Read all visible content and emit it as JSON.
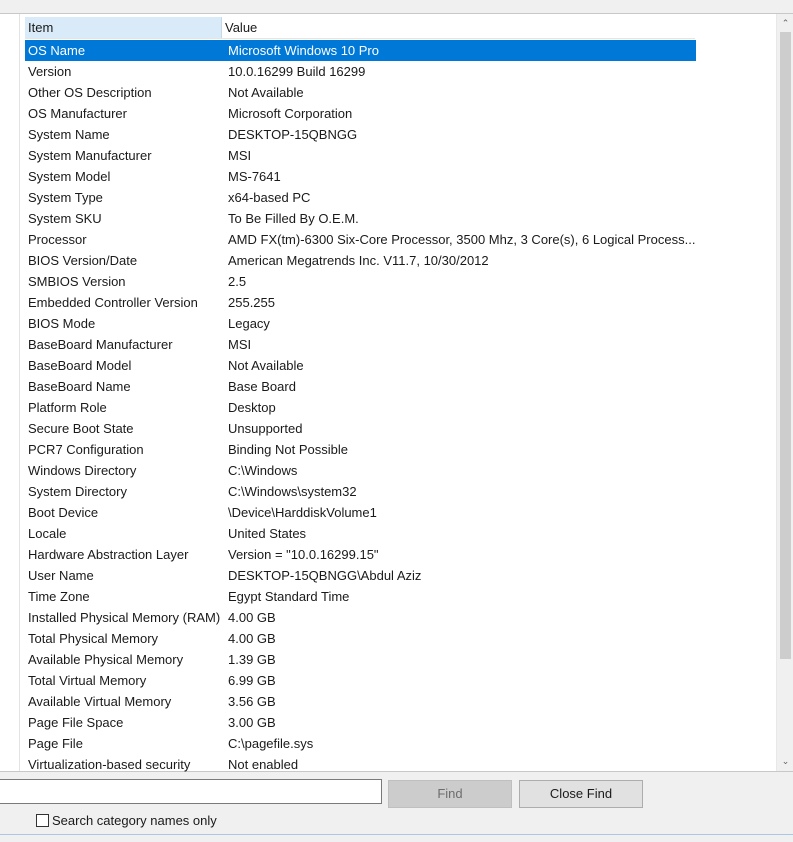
{
  "table": {
    "headers": {
      "item": "Item",
      "value": "Value"
    },
    "rows": [
      {
        "item": "OS Name",
        "value": "Microsoft Windows 10 Pro",
        "selected": true
      },
      {
        "item": "Version",
        "value": "10.0.16299 Build 16299"
      },
      {
        "item": "Other OS Description",
        "value": "Not Available"
      },
      {
        "item": "OS Manufacturer",
        "value": "Microsoft Corporation"
      },
      {
        "item": "System Name",
        "value": "DESKTOP-15QBNGG"
      },
      {
        "item": "System Manufacturer",
        "value": "MSI"
      },
      {
        "item": "System Model",
        "value": "MS-7641"
      },
      {
        "item": "System Type",
        "value": "x64-based PC"
      },
      {
        "item": "System SKU",
        "value": "To Be Filled By O.E.M."
      },
      {
        "item": "Processor",
        "value": "AMD FX(tm)-6300 Six-Core Processor, 3500 Mhz, 3 Core(s), 6 Logical Process..."
      },
      {
        "item": "BIOS Version/Date",
        "value": "American Megatrends Inc. V11.7, 10/30/2012"
      },
      {
        "item": "SMBIOS Version",
        "value": "2.5"
      },
      {
        "item": "Embedded Controller Version",
        "value": "255.255"
      },
      {
        "item": "BIOS Mode",
        "value": "Legacy"
      },
      {
        "item": "BaseBoard Manufacturer",
        "value": "MSI"
      },
      {
        "item": "BaseBoard Model",
        "value": "Not Available"
      },
      {
        "item": "BaseBoard Name",
        "value": "Base Board"
      },
      {
        "item": "Platform Role",
        "value": "Desktop"
      },
      {
        "item": "Secure Boot State",
        "value": "Unsupported"
      },
      {
        "item": "PCR7 Configuration",
        "value": "Binding Not Possible"
      },
      {
        "item": "Windows Directory",
        "value": "C:\\Windows"
      },
      {
        "item": "System Directory",
        "value": "C:\\Windows\\system32"
      },
      {
        "item": "Boot Device",
        "value": "\\Device\\HarddiskVolume1"
      },
      {
        "item": "Locale",
        "value": "United States"
      },
      {
        "item": "Hardware Abstraction Layer",
        "value": "Version = \"10.0.16299.15\""
      },
      {
        "item": "User Name",
        "value": "DESKTOP-15QBNGG\\Abdul Aziz"
      },
      {
        "item": "Time Zone",
        "value": "Egypt Standard Time"
      },
      {
        "item": "Installed Physical Memory (RAM)",
        "value": "4.00 GB"
      },
      {
        "item": "Total Physical Memory",
        "value": "4.00 GB"
      },
      {
        "item": "Available Physical Memory",
        "value": "1.39 GB"
      },
      {
        "item": "Total Virtual Memory",
        "value": "6.99 GB"
      },
      {
        "item": "Available Virtual Memory",
        "value": "3.56 GB"
      },
      {
        "item": "Page File Space",
        "value": "3.00 GB"
      },
      {
        "item": "Page File",
        "value": "C:\\pagefile.sys"
      },
      {
        "item": "Virtualization-based security",
        "value": "Not enabled"
      }
    ]
  },
  "scrollbar": {
    "up_icon": "chevron-up-icon",
    "down_icon": "chevron-down-icon",
    "up_glyph": "⌃",
    "down_glyph": "⌄"
  },
  "find": {
    "input_value": "",
    "find_label": "Find",
    "close_find_label": "Close Find",
    "checkbox_label": "Search category names only",
    "checkbox_checked": false
  },
  "colors": {
    "selection": "#0078d7",
    "header_highlight": "#d9ebf9"
  }
}
